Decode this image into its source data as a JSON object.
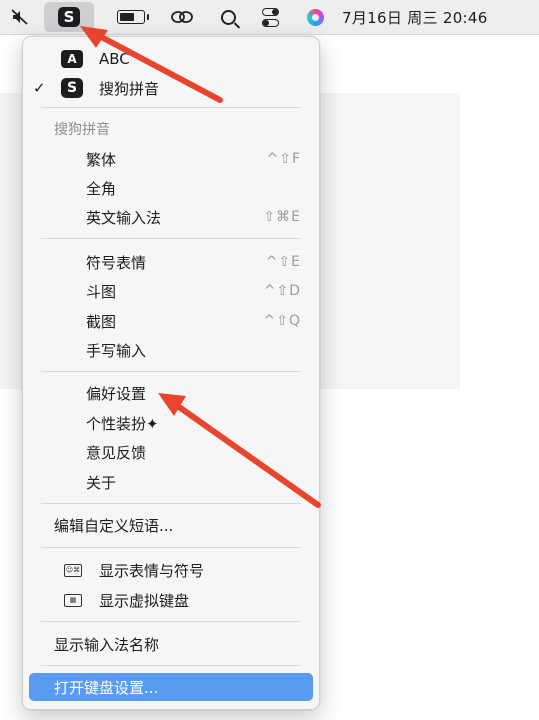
{
  "menubar": {
    "mute_icon": "mute-icon",
    "clock": "7月16日 周三  20:46",
    "sogou_glyph": "S"
  },
  "menu": {
    "abc_icon_text": "A",
    "abc_label": "ABC",
    "sogou_check": "✓",
    "sogou_icon_text": "S",
    "sogou_label": "搜狗拼音",
    "section_title": "搜狗拼音",
    "items_group1": [
      {
        "label": "繁体",
        "shortcut": "^⇧F"
      },
      {
        "label": "全角",
        "shortcut": ""
      },
      {
        "label": "英文输入法",
        "shortcut": "⇧⌘E"
      }
    ],
    "items_group2": [
      {
        "label": "符号表情",
        "shortcut": "^⇧E"
      },
      {
        "label": "斗图",
        "shortcut": "^⇧D"
      },
      {
        "label": "截图",
        "shortcut": "^⇧Q"
      },
      {
        "label": "手写输入",
        "shortcut": ""
      }
    ],
    "items_group3": [
      {
        "label": "偏好设置"
      },
      {
        "label": "个性装扮✦"
      },
      {
        "label": "意见反馈"
      },
      {
        "label": "关于"
      }
    ],
    "edit_phrases": "编辑自定义短语...",
    "show_emoji": "显示表情与符号",
    "show_keyboard": "显示虚拟键盘",
    "show_input_name": "显示输入法名称",
    "open_keyboard_settings": "打开键盘设置..."
  },
  "colors": {
    "highlight": "#5a9bf2",
    "arrow": "#e8452e"
  }
}
